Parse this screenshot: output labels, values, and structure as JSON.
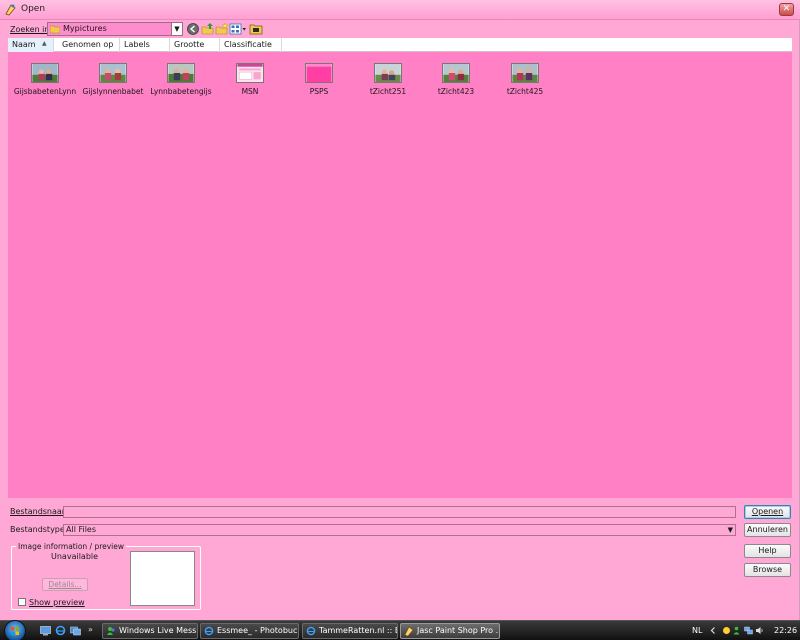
{
  "window": {
    "title": "Open",
    "close_glyph": "✕"
  },
  "lookin": {
    "label": "Zoeken in:",
    "value": "Mypictures"
  },
  "columns": [
    {
      "label": "Naam"
    },
    {
      "label": "Genomen op"
    },
    {
      "label": "Labels"
    },
    {
      "label": "Grootte"
    },
    {
      "label": "Classificatie"
    }
  ],
  "files": [
    {
      "name": "GijsbabetenLynn",
      "kind": "photo"
    },
    {
      "name": "Gijslynnenbabet",
      "kind": "photo"
    },
    {
      "name": "Lynnbabetengijs",
      "kind": "photo"
    },
    {
      "name": "MSN",
      "kind": "screenshot"
    },
    {
      "name": "PSPS",
      "kind": "pink-image"
    },
    {
      "name": "tZicht251",
      "kind": "photo"
    },
    {
      "name": "tZicht423",
      "kind": "photo"
    },
    {
      "name": "tZicht425",
      "kind": "photo"
    }
  ],
  "form": {
    "filename_label": "Bestandsnaam:",
    "filename_value": "",
    "filetype_label": "Bestandstypen:",
    "filetype_value": "All Files"
  },
  "buttons": {
    "open": "Openen",
    "cancel": "Annuleren",
    "help": "Help",
    "browse": "Browse"
  },
  "preview": {
    "group_label": "Image information / preview",
    "unavailable": "Unavailable",
    "details": "Details...",
    "show_preview": "Show preview",
    "show_preview_checked": false
  },
  "taskbar": {
    "tasks": [
      {
        "label": "Windows Live Mess...",
        "icon": "messenger-icon",
        "active": false
      },
      {
        "label": "Essmee_ - Photobuc...",
        "icon": "ie-icon",
        "active": false
      },
      {
        "label": "TammeRatten.nl :: B...",
        "icon": "ie-icon",
        "active": false
      },
      {
        "label": "Jasc Paint Shop Pro ...",
        "icon": "paintshop-icon",
        "active": true
      }
    ],
    "language": "NL",
    "clock": "22:26"
  },
  "colors": {
    "file_area": "#ff80c4",
    "dialog_bg": "#ffa8d6",
    "accent_button": "#3c7fb1"
  }
}
